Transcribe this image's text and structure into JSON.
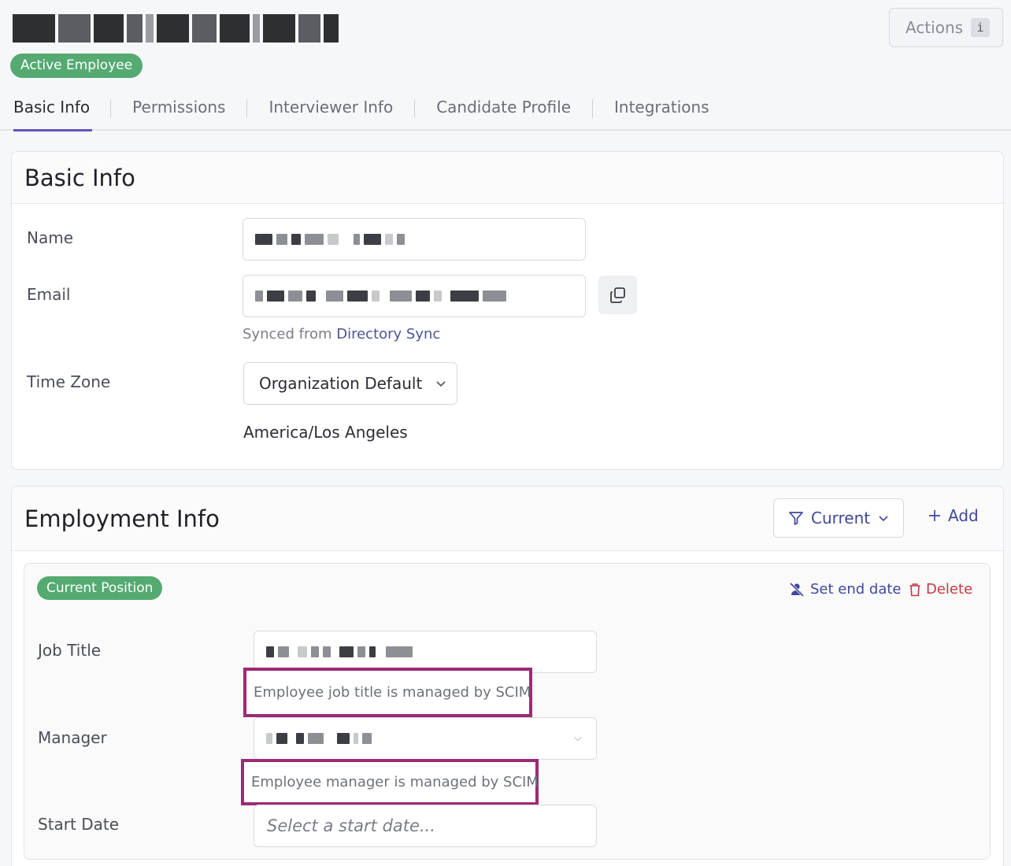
{
  "header": {
    "employee_name": "George Michael Bluth",
    "status": "Active Employee",
    "actions_label": "Actions",
    "actions_shortcut": "i"
  },
  "tabs": [
    {
      "label": "Basic Info",
      "active": true
    },
    {
      "label": "Permissions",
      "active": false
    },
    {
      "label": "Interviewer Info",
      "active": false
    },
    {
      "label": "Candidate Profile",
      "active": false
    },
    {
      "label": "Integrations",
      "active": false
    }
  ],
  "basic_info": {
    "title": "Basic Info",
    "name_label": "Name",
    "name_value": "[redacted]",
    "email_label": "Email",
    "email_value": "[redacted]",
    "sync_prefix": "Synced from",
    "sync_source": "Directory Sync",
    "timezone_label": "Time Zone",
    "timezone_selected": "Organization Default",
    "timezone_resolved": "America/Los Angeles"
  },
  "employment_info": {
    "title": "Employment Info",
    "filter_label": "Current",
    "add_label": "Add",
    "position": {
      "badge": "Current Position",
      "set_end_date_label": "Set end date",
      "delete_label": "Delete",
      "job_title_label": "Job Title",
      "job_title_value": "[redacted]",
      "job_title_note": "Employee job title is managed by SCIM",
      "manager_label": "Manager",
      "manager_value": "[redacted]",
      "manager_note": "Employee manager is managed by SCIM",
      "start_date_label": "Start Date",
      "start_date_placeholder": "Select a start date..."
    }
  },
  "colors": {
    "accent": "#6255c0",
    "link": "#3f47a0",
    "success": "#55aa72",
    "danger": "#c8383c",
    "highlight": "#9b2b74"
  },
  "icons": [
    "copy-icon",
    "chevron-down-icon",
    "filter-icon",
    "plus-icon",
    "user-off-icon",
    "trash-icon"
  ]
}
